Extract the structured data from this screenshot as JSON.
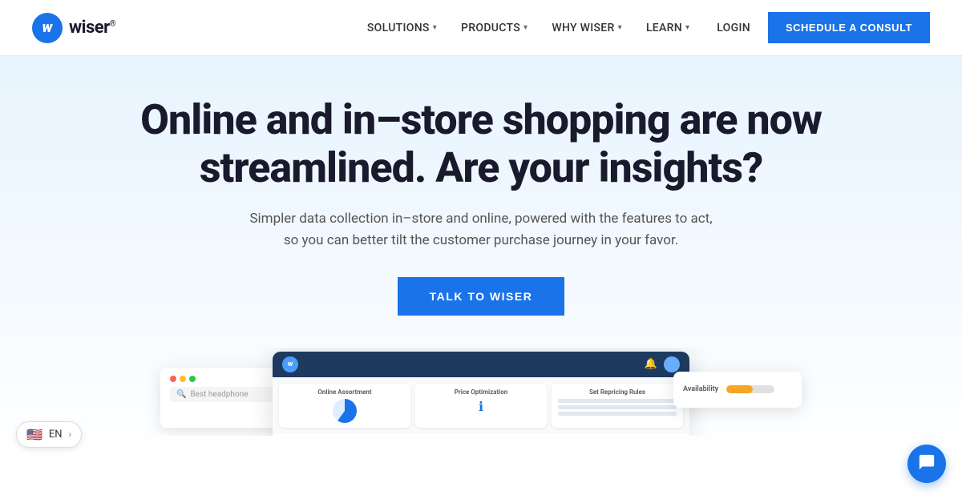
{
  "navbar": {
    "logo_letter": "w",
    "logo_name": "wiser",
    "logo_trademark": "®",
    "nav_items": [
      {
        "label": "SOLUTIONS",
        "has_dropdown": true
      },
      {
        "label": "PRODUCTS",
        "has_dropdown": true
      },
      {
        "label": "WHY WISER",
        "has_dropdown": true
      },
      {
        "label": "LEARN",
        "has_dropdown": true
      }
    ],
    "login_label": "LOGIN",
    "cta_label": "SCHEDULE A CONSULT"
  },
  "hero": {
    "title": "Online and in–store shopping are now streamlined. Are your insights?",
    "subtitle": "Simpler data collection in–store and online, powered with the features to act, so you can better tilt the customer purchase journey in your favor.",
    "cta_label": "TALK TO WISER"
  },
  "screenshots": {
    "search_placeholder": "Best headphone",
    "app_cards": [
      {
        "title": "Online Assortment"
      },
      {
        "title": "Price Optimization"
      },
      {
        "title": "Set Repricing Rules"
      }
    ],
    "availability_label": "Availability"
  },
  "language": {
    "code": "EN",
    "flag": "🇺🇸"
  },
  "chat": {
    "icon": "💬"
  }
}
